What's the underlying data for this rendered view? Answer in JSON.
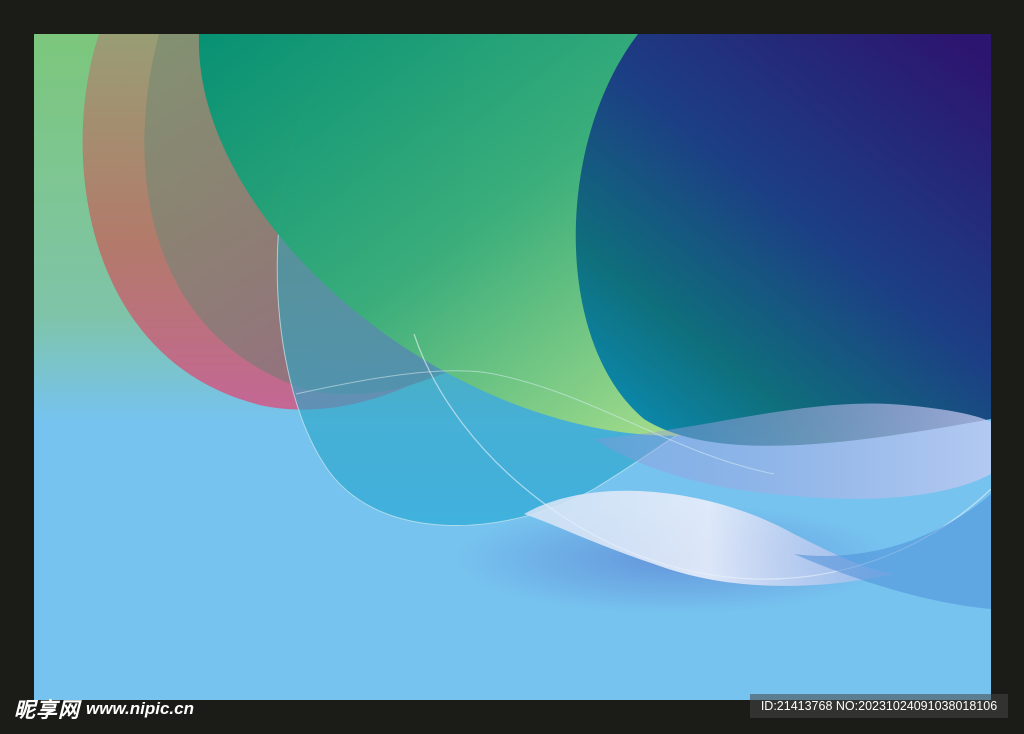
{
  "watermark": {
    "site_name": "昵享网",
    "site_url": "www.nipic.cn",
    "id_label": "ID:21413768 NO:20231024091038018106"
  },
  "artwork": {
    "icon": "abstract-wave-background",
    "colors": {
      "frame": "#1b1b17",
      "sky_blue": "#76c3ef",
      "light_green": "#7fc67f",
      "emerald": "#0e9a78",
      "indigo": "#2a1870",
      "rose": "#c2607e",
      "lavender": "#c9cdef"
    }
  }
}
